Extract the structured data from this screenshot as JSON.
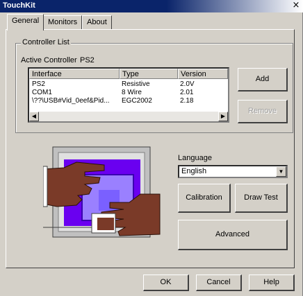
{
  "window": {
    "title": "TouchKit",
    "close_glyph": "×"
  },
  "tabs": [
    {
      "label": "General",
      "active": true
    },
    {
      "label": "Monitors",
      "active": false
    },
    {
      "label": "About",
      "active": false
    }
  ],
  "controller": {
    "group_label": "Controller List",
    "active_label": "Active Controller",
    "active_value": "PS2",
    "columns": [
      "Interface",
      "Type",
      "Version"
    ],
    "rows": [
      {
        "interface": "PS2",
        "type": "Resistive",
        "version": "2.0V"
      },
      {
        "interface": "COM1",
        "type": "8 Wire",
        "version": "2.01"
      },
      {
        "interface": "\\??\\USB#Vid_0eef&Pid...",
        "type": "EGC2002",
        "version": "2.18"
      }
    ],
    "add_label": "Add",
    "remove_label": "Remove"
  },
  "language": {
    "label": "Language",
    "selected": "English"
  },
  "actions": {
    "calibration": "Calibration",
    "draw_test": "Draw Test",
    "advanced": "Advanced"
  },
  "footer": {
    "ok": "OK",
    "cancel": "Cancel",
    "help": "Help"
  },
  "colors": {
    "dialog": "#d4d0c8",
    "titlebar": "#0a246a",
    "monitor_frame": "#c0c0c0",
    "screen_purple": "#6a00f0",
    "screen_inner": "#9a80ff",
    "hand": "#7a3a28",
    "cuff": "#ffffff"
  },
  "icons": [
    "close-icon",
    "scroll-left-icon",
    "scroll-right-icon",
    "dropdown-arrow-icon",
    "touch-hands-illustration"
  ]
}
